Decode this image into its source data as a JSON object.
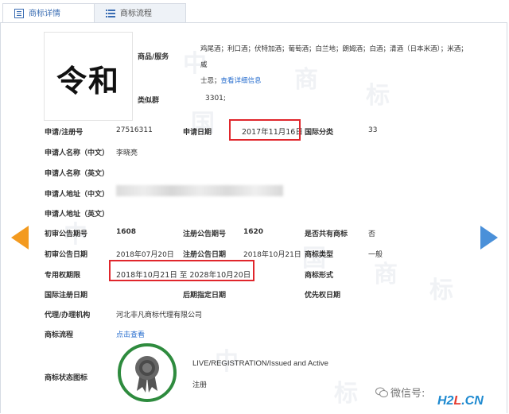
{
  "tabs": [
    {
      "label": "商标详情",
      "icon": "document-list-icon"
    },
    {
      "label": "商标流程",
      "icon": "list-icon"
    }
  ],
  "logo_text": "令和",
  "goods_services": {
    "label": "商品/服务",
    "line1": "鸡尾酒；利口酒；伏特加酒；葡萄酒；白兰地；朗姆酒；白酒；清酒（日本米酒）；米酒；威",
    "line2_prefix": "士忌；",
    "detail_link": "查看详细信息"
  },
  "similar_group": {
    "label": "类似群",
    "value": "3301;"
  },
  "fields": {
    "reg_no": {
      "label": "申请/注册号",
      "value": "27516311"
    },
    "app_date": {
      "label": "申请日期",
      "value": "2017年11月16日"
    },
    "intl_class": {
      "label": "国际分类",
      "value": "33"
    },
    "applicant_cn": {
      "label": "申请人名称（中文）",
      "value": "李晓亮"
    },
    "applicant_en": {
      "label": "申请人名称（英文）",
      "value": ""
    },
    "address_cn": {
      "label": "申请人地址（中文）",
      "value": ""
    },
    "address_en": {
      "label": "申请人地址（英文）",
      "value": ""
    },
    "prelim_pub_no": {
      "label": "初审公告期号",
      "value": "1608"
    },
    "reg_pub_no": {
      "label": "注册公告期号",
      "value": "1620"
    },
    "shared": {
      "label": "是否共有商标",
      "value": "否"
    },
    "prelim_pub_date": {
      "label": "初审公告日期",
      "value": "2018年07月20日"
    },
    "reg_pub_date": {
      "label": "注册公告日期",
      "value": "2018年10月21日"
    },
    "tm_type": {
      "label": "商标类型",
      "value": "一般"
    },
    "exclusive_period": {
      "label": "专用权期限",
      "value": "2018年10月21日 至 2028年10月20日"
    },
    "tm_form": {
      "label": "商标形式",
      "value": ""
    },
    "intl_reg_date": {
      "label": "国际注册日期",
      "value": ""
    },
    "later_date": {
      "label": "后期指定日期",
      "value": ""
    },
    "priority_date": {
      "label": "优先权日期",
      "value": ""
    },
    "agent": {
      "label": "代理/办理机构",
      "value": "河北非凡商标代理有限公司"
    },
    "process": {
      "label": "商标流程",
      "value": "点击查看"
    },
    "status_icon": {
      "label": "商标状态图标",
      "status_en": "LIVE/REGISTRATION/Issued and Active",
      "status_cn": "注册"
    }
  },
  "watermarks": [
    "中",
    "国",
    "商",
    "标"
  ],
  "footer": {
    "wechat": "微信号: ",
    "h2l_a": "H2",
    "h2l_b": "L",
    "h2l_c": ".CN"
  },
  "colors": {
    "highlight": "#e0262c",
    "link": "#2a6fcf",
    "seal": "#2e8b3e",
    "prev_arrow": "#f39a1f",
    "next_arrow": "#4a90d9"
  }
}
